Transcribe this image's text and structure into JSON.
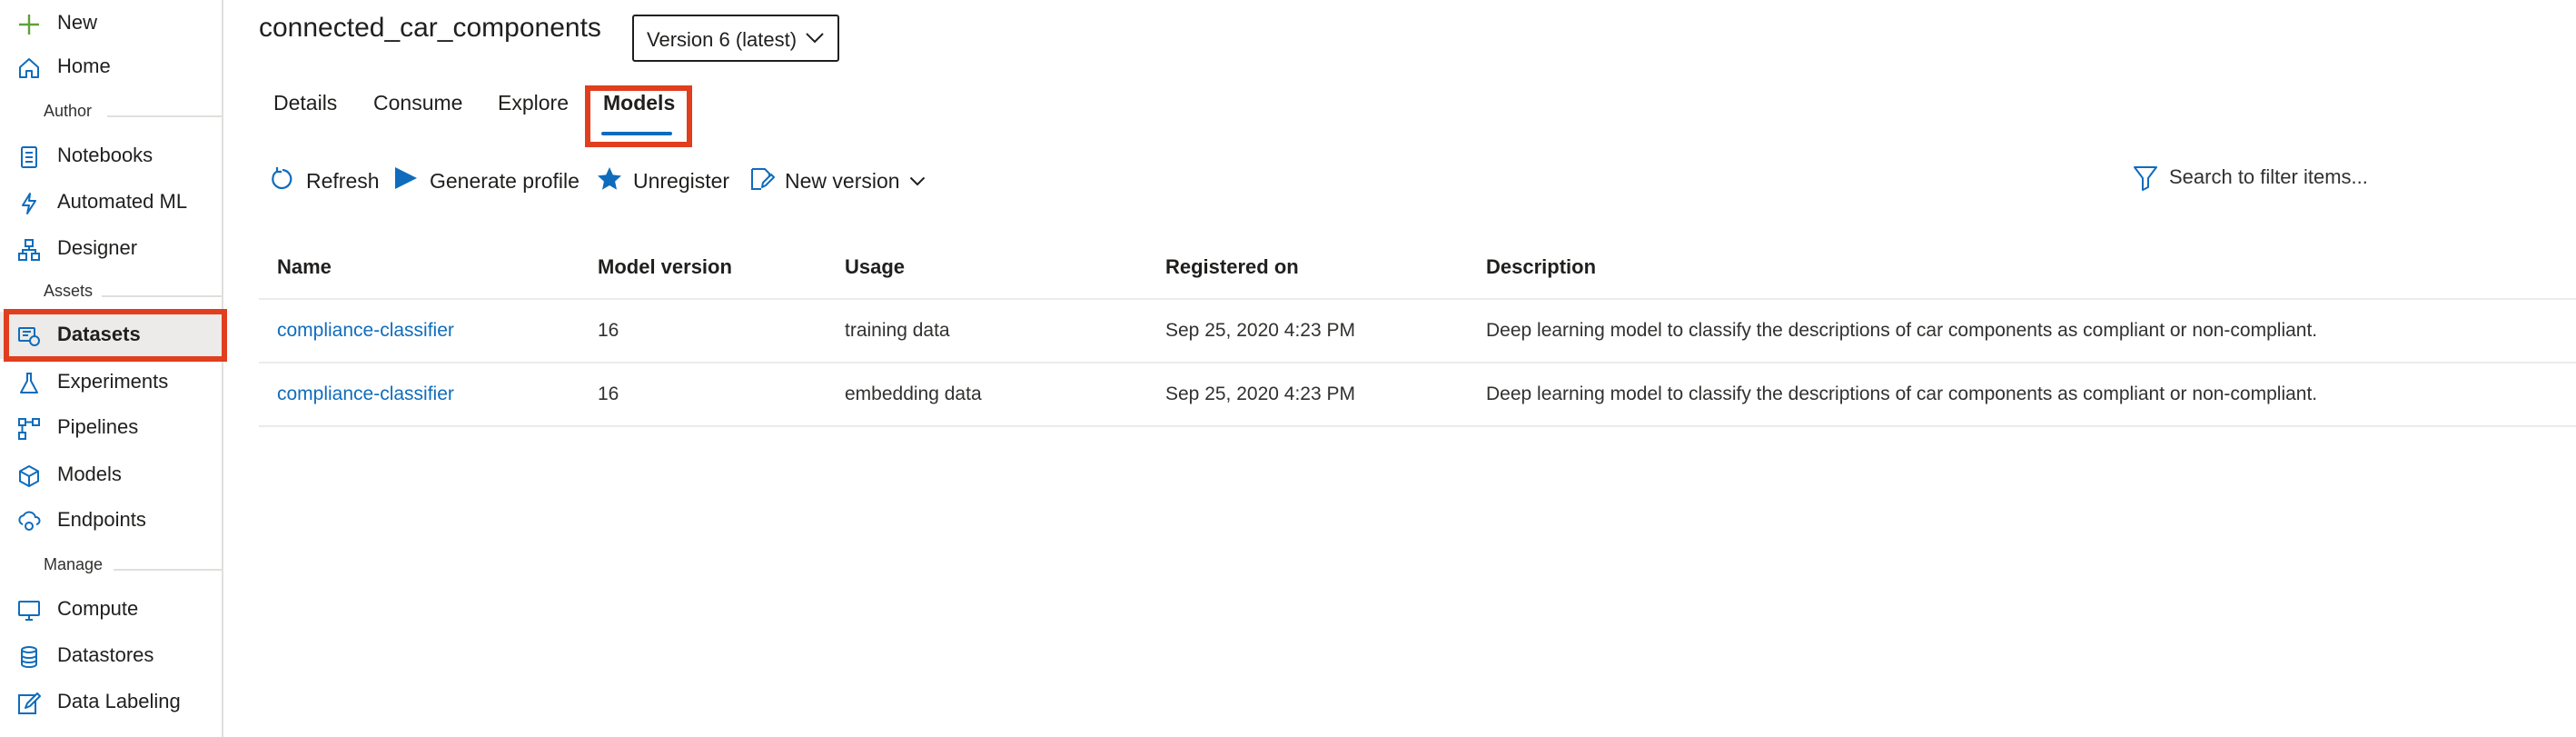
{
  "sidebar": {
    "new_label": "New",
    "home_label": "Home",
    "author_section": "Author",
    "notebooks_label": "Notebooks",
    "automl_label": "Automated ML",
    "designer_label": "Designer",
    "assets_section": "Assets",
    "datasets_label": "Datasets",
    "experiments_label": "Experiments",
    "pipelines_label": "Pipelines",
    "models_label": "Models",
    "endpoints_label": "Endpoints",
    "manage_section": "Manage",
    "compute_label": "Compute",
    "datastores_label": "Datastores",
    "datalabeling_label": "Data Labeling"
  },
  "header": {
    "title": "connected_car_components",
    "version_selected": "Version 6 (latest)"
  },
  "tabs": {
    "details": "Details",
    "consume": "Consume",
    "explore": "Explore",
    "models": "Models"
  },
  "toolbar": {
    "refresh": "Refresh",
    "generate_profile": "Generate profile",
    "unregister": "Unregister",
    "new_version": "New version",
    "search_placeholder": "Search to filter items..."
  },
  "table": {
    "headers": {
      "name": "Name",
      "model_version": "Model version",
      "usage": "Usage",
      "registered_on": "Registered on",
      "description": "Description"
    },
    "rows": [
      {
        "name": "compliance-classifier",
        "model_version": "16",
        "usage": "training data",
        "registered_on": "Sep 25, 2020 4:23 PM",
        "description": "Deep learning model to classify the descriptions of car components as compliant or non-compliant."
      },
      {
        "name": "compliance-classifier",
        "model_version": "16",
        "usage": "embedding data",
        "registered_on": "Sep 25, 2020 4:23 PM",
        "description": "Deep learning model to classify the descriptions of car components as compliant or non-compliant."
      }
    ]
  },
  "colors": {
    "accent": "#0f6cbd",
    "highlight": "#e03e1e",
    "new_icon": "#5ea03b"
  }
}
